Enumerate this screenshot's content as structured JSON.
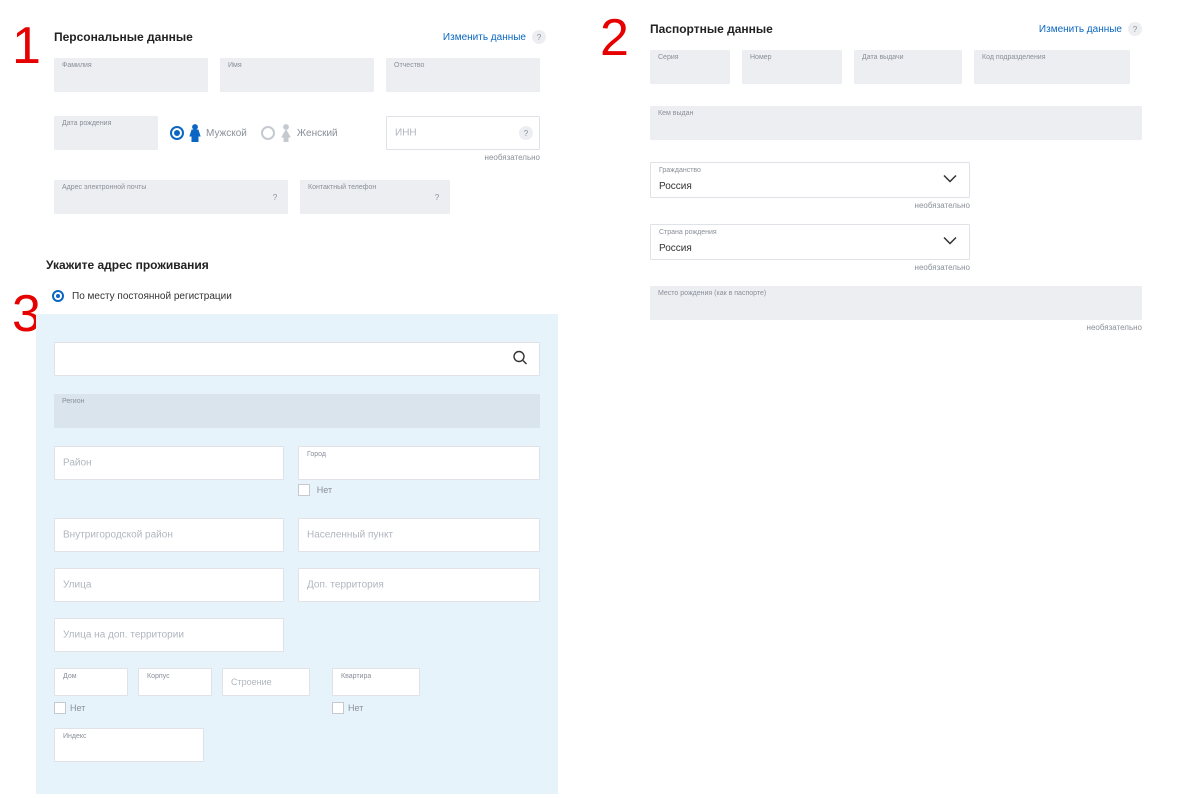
{
  "nums": {
    "one": "1",
    "two": "2",
    "three": "3"
  },
  "common": {
    "change_link": "Изменить данные",
    "help": "?",
    "optional": "необязательно",
    "net": "Нет"
  },
  "personal": {
    "title": "Персональные данные",
    "surname": "Фамилия",
    "name": "Имя",
    "patronymic": "Отчество",
    "birthdate": "Дата рождения",
    "male": "Мужской",
    "female": "Женский",
    "inn": "ИНН",
    "email": "Адрес электронной почты",
    "phone": "Контактный телефон"
  },
  "passport": {
    "title": "Паспортные данные",
    "series": "Серия",
    "number": "Номер",
    "date": "Дата выдачи",
    "code": "Код подразделения",
    "issued": "Кем выдан",
    "citizenship_lab": "Гражданство",
    "citizenship_val": "Россия",
    "birth_country_lab": "Страна рождения",
    "birth_country_val": "Россия",
    "birth_place": "Место рождения (как в паспорте)"
  },
  "address": {
    "title": "Укажите адрес проживания",
    "radio": "По месту постоянной регистрации",
    "region": "Регион",
    "district": "Район",
    "city": "Город",
    "urban_district": "Внутригородской район",
    "locality": "Населенный пункт",
    "street": "Улица",
    "add_territory": "Доп. территория",
    "street_add": "Улица на доп. территории",
    "house": "Дом",
    "korpus": "Корпус",
    "building": "Строение",
    "flat": "Квартира",
    "index": "Индекс"
  }
}
